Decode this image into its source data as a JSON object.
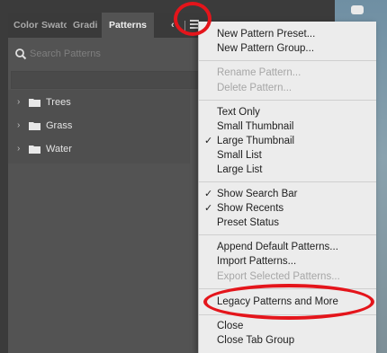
{
  "panel": {
    "tabs": [
      "Color",
      "Swatc",
      "Gradi",
      "Patterns"
    ],
    "collapse_glyph": "‹",
    "search": {
      "placeholder": "Search Patterns",
      "value": ""
    },
    "groups": [
      {
        "label": "Trees"
      },
      {
        "label": "Grass"
      },
      {
        "label": "Water"
      }
    ]
  },
  "menu": {
    "sections": [
      [
        {
          "label": "New Pattern Preset...",
          "enabled": true
        },
        {
          "label": "New Pattern Group...",
          "enabled": true
        }
      ],
      [
        {
          "label": "Rename Pattern...",
          "enabled": false
        },
        {
          "label": "Delete Pattern...",
          "enabled": false
        }
      ],
      [
        {
          "label": "Text Only",
          "enabled": true
        },
        {
          "label": "Small Thumbnail",
          "enabled": true
        },
        {
          "label": "Large Thumbnail",
          "enabled": true,
          "checked": true
        },
        {
          "label": "Small List",
          "enabled": true
        },
        {
          "label": "Large List",
          "enabled": true
        }
      ],
      [
        {
          "label": "Show Search Bar",
          "enabled": true,
          "checked": true
        },
        {
          "label": "Show Recents",
          "enabled": true,
          "checked": true
        },
        {
          "label": "Preset Status",
          "enabled": true
        }
      ],
      [
        {
          "label": "Append Default Patterns...",
          "enabled": true
        },
        {
          "label": "Import Patterns...",
          "enabled": true
        },
        {
          "label": "Export Selected Patterns...",
          "enabled": false
        }
      ],
      [
        {
          "label": "Legacy Patterns and More",
          "enabled": true
        }
      ],
      [
        {
          "label": "Close",
          "enabled": true
        },
        {
          "label": "Close Tab Group",
          "enabled": true
        }
      ]
    ],
    "check_glyph": "✓"
  },
  "annotation_color": "#e4151b"
}
